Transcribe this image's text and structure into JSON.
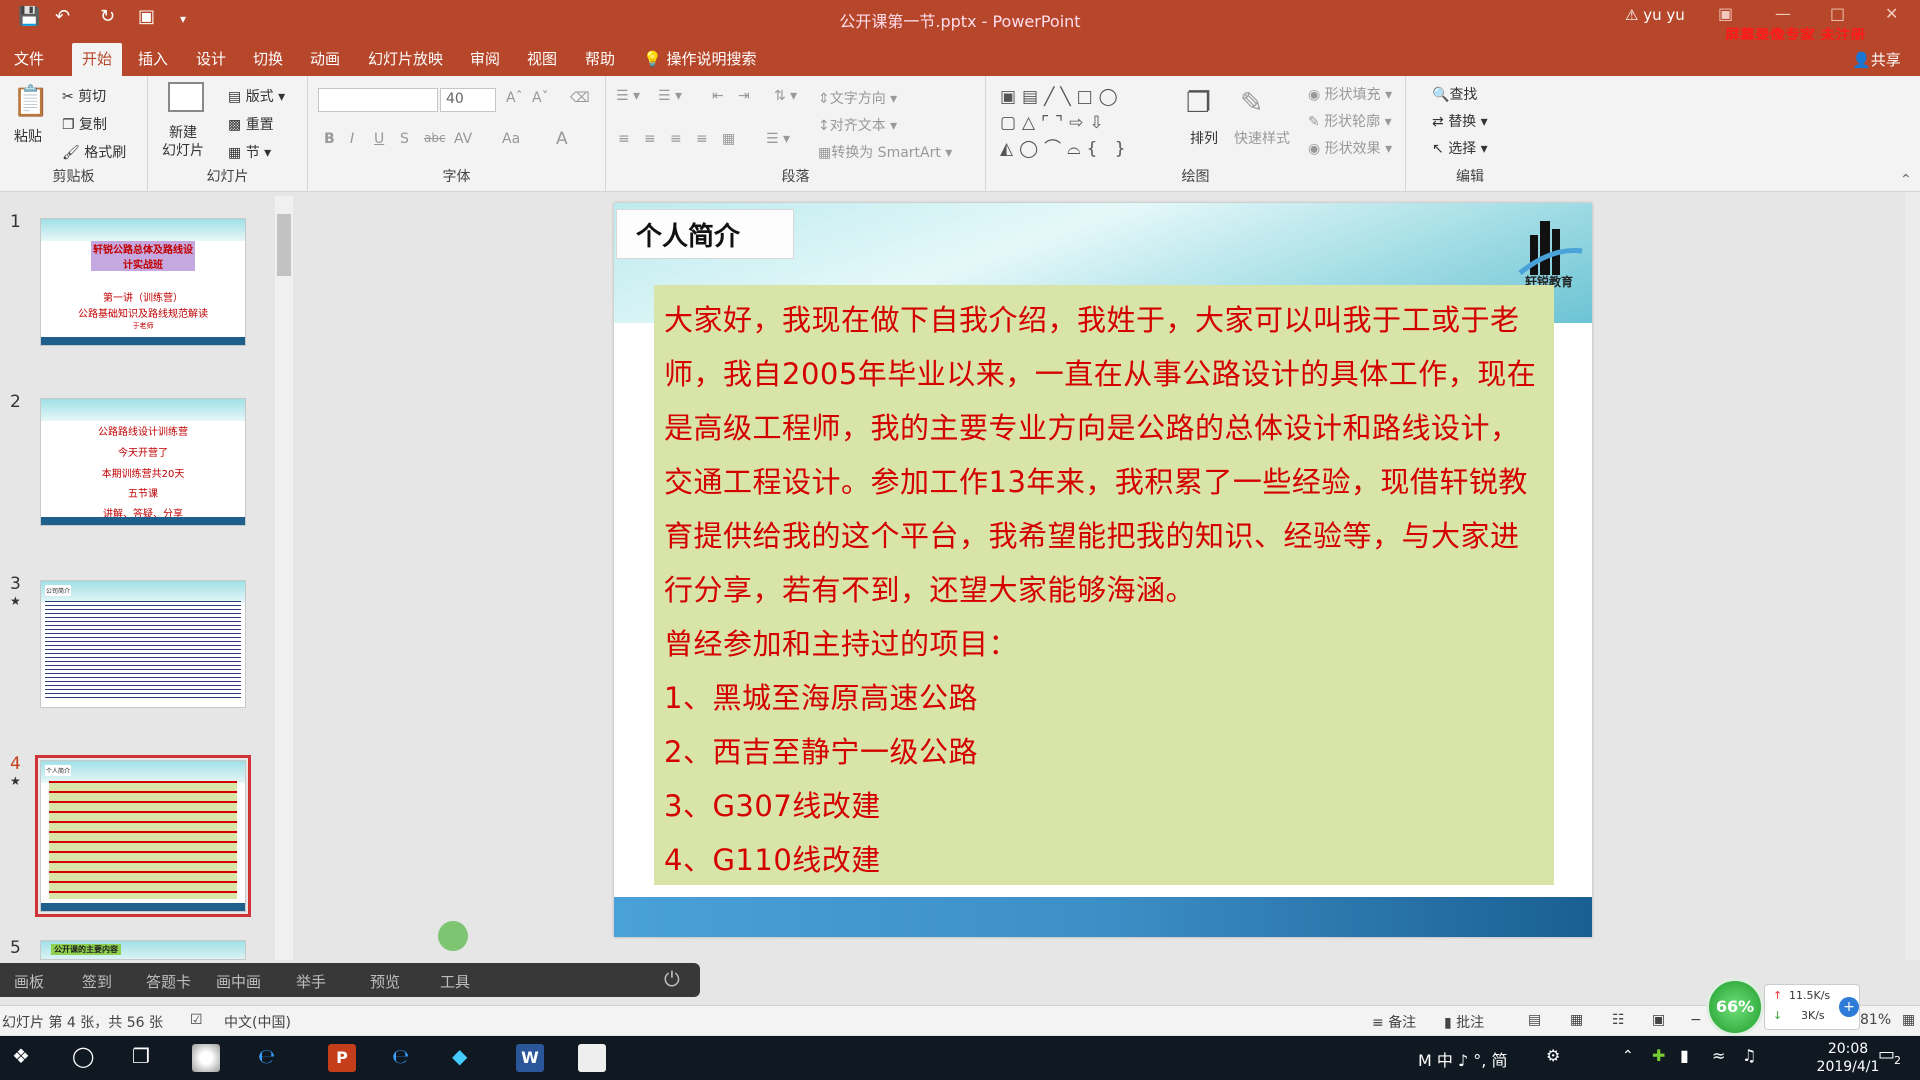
{
  "titlebar": {
    "title": "公开课第一节.pptx  -  PowerPoint",
    "user": "yu yu",
    "watermark": "屏幕录像专家  未注册"
  },
  "tabs": [
    "文件",
    "开始",
    "插入",
    "设计",
    "切换",
    "动画",
    "幻灯片放映",
    "审阅",
    "视图",
    "帮助"
  ],
  "active_tab": "开始",
  "tell_me": "操作说明搜索",
  "share": "共享",
  "ribbon": {
    "clipboard": {
      "label": "剪贴板",
      "paste": "粘贴",
      "cut": "剪切",
      "copy": "复制",
      "format_painter": "格式刷"
    },
    "slides": {
      "label": "幻灯片",
      "new_slide": "新建\n幻灯片",
      "layout": "版式",
      "reset": "重置",
      "section": "节"
    },
    "font": {
      "label": "字体",
      "font_name": "",
      "font_size": "40",
      "bold": "B",
      "italic": "I",
      "underline": "U",
      "shadow": "S",
      "strike": "abc",
      "spacing": "AV",
      "case": "Aa",
      "color": "A"
    },
    "paragraph": {
      "label": "段落",
      "text_direction": "文字方向",
      "align_text": "对齐文本",
      "smartart": "转换为 SmartArt"
    },
    "drawing": {
      "label": "绘图",
      "arrange": "排列",
      "quick_styles": "快速样式",
      "shape_fill": "形状填充",
      "shape_outline": "形状轮廓",
      "shape_effects": "形状效果"
    },
    "editing": {
      "label": "编辑",
      "find": "查找",
      "replace": "替换",
      "select": "选择"
    }
  },
  "thumbnails": [
    {
      "num": "1",
      "lines": [
        "轩锐公路总体及路线设计实战班",
        "第一讲（训练营）",
        "公路基础知识及路线规范解读",
        "于老师"
      ]
    },
    {
      "num": "2",
      "lines": [
        "公路路线设计训练营",
        "今天开营了",
        "本期训练营共20天",
        "五节课",
        "讲解、答疑、分享"
      ]
    },
    {
      "num": "3",
      "lines": [
        "公司简介"
      ]
    },
    {
      "num": "4",
      "lines": [
        "个人简介"
      ]
    },
    {
      "num": "5",
      "lines": [
        "公开课的主要内容"
      ]
    }
  ],
  "slide": {
    "title": "个人简介",
    "logo_text": "轩锐教育",
    "paragraphs": [
      "大家好，我现在做下自我介绍，我姓于，大家可以叫我于工或于老",
      "师，我自2005年毕业以来，一直在从事公路设计的具体工作，现在",
      "是高级工程师，我的主要专业方向是公路的总体设计和路线设计，",
      "交通工程设计。参加工作13年来，我积累了一些经验，现借轩锐教",
      "育提供给我的这个平台，我希望能把我的知识、经验等，与大家进",
      "行分享，若有不到，还望大家能够海涵。",
      "曾经参加和主持过的项目：",
      "1、黑城至海原高速公路",
      "2、西吉至静宁一级公路",
      "3、G307线改建",
      "4、G110线改建"
    ]
  },
  "recording_toolbar": [
    "画板",
    "签到",
    "答题卡",
    "画中画",
    "举手",
    "预览",
    "工具"
  ],
  "statusbar": {
    "slide_info": "幻灯片 第 4 张，共 56 张",
    "language": "中文(中国)",
    "notes": "备注",
    "comments": "批注",
    "zoom": "81%"
  },
  "network": {
    "percent": "66%",
    "up": "11.5K/s",
    "down": "3K/s"
  },
  "taskbar": {
    "ime": "M 中 ♪ °, 简",
    "time": "20:08",
    "date": "2019/4/1",
    "notifications": "2"
  },
  "colors": {
    "accent": "#b7472a",
    "slide_text": "#d40000",
    "text_box": "#d8e4a8"
  }
}
